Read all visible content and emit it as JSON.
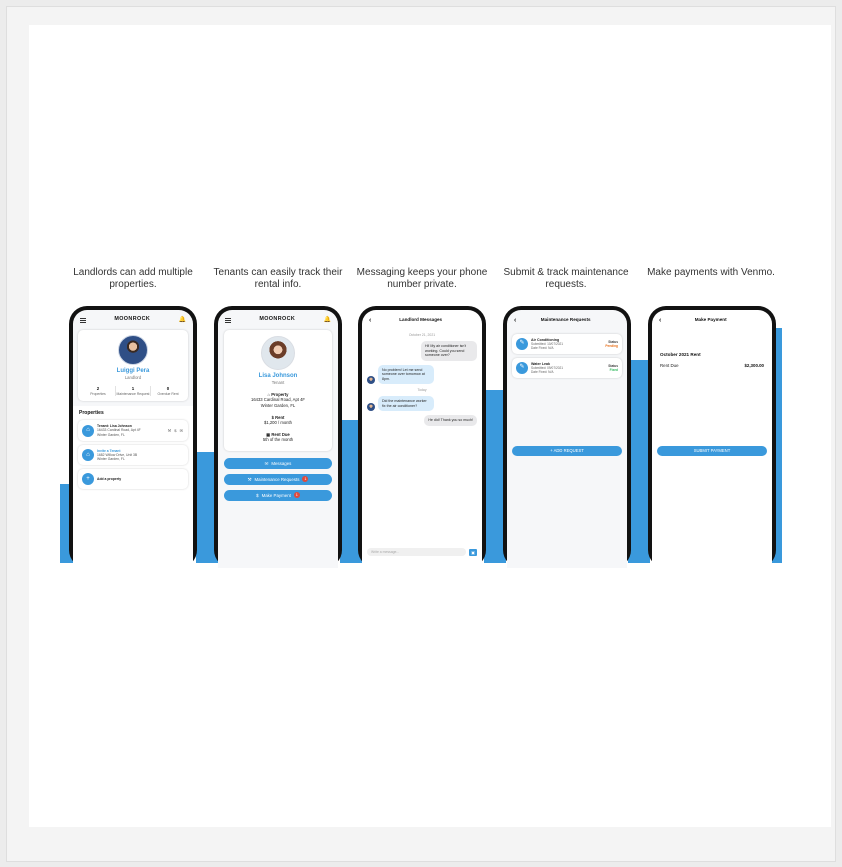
{
  "captions": [
    "Landlords can add multiple properties.",
    "Tenants can easily track their rental info.",
    "Messaging keeps your phone number private.",
    "Submit & track maintenance requests.",
    "Make payments with Venmo."
  ],
  "brand": {
    "logo": "MOONROCK",
    "accent": "#3a99dc"
  },
  "landlord": {
    "name": "Luiggi Pera",
    "role": "Landlord",
    "stats": [
      {
        "value": "2",
        "label": "Properties"
      },
      {
        "value": "1",
        "label": "Maintenance Request"
      },
      {
        "value": "0",
        "label": "Overdue Rent"
      }
    ],
    "properties_heading": "Properties",
    "properties": [
      {
        "title": "Tenant: Lisa Johnson",
        "line1": "16433 Cardinal Road, Apt 4F",
        "line2": "Winter Garden, FL",
        "icons": "⚒ $ ✉"
      },
      {
        "title": "Invite a Tenant",
        "line1": "1682 Willow Drive, Unit 3B",
        "line2": "Winter Garden, FL"
      }
    ],
    "add_label": "Add a property"
  },
  "tenant": {
    "name": "Lisa Johnson",
    "role": "Tenant",
    "property_label": "Property",
    "address1": "16433 Cardinal Road, Apt 4F",
    "address2": "Winter Garden, FL",
    "rent_label": "Rent",
    "rent_value": "$1,200 / month",
    "due_label": "Rent Due",
    "due_value": "5th of the month",
    "buttons": [
      {
        "label": "Messages",
        "icon": "✉",
        "badge": ""
      },
      {
        "label": "Maintenance Requests",
        "icon": "⚒",
        "badge": "1"
      },
      {
        "label": "Make Payment",
        "icon": "$",
        "badge": "1"
      }
    ]
  },
  "messages": {
    "title": "Landlord Messages",
    "date1": "October 21, 2021",
    "date2": "Today",
    "thread": [
      {
        "from": "me",
        "text": "Hi! My air conditioner isn't working. Could you send someone over?"
      },
      {
        "from": "them",
        "text": "No problem! Let me send someone over tomorrow at 8pm."
      },
      {
        "from": "them",
        "text": "Did the maintenance worker fix the air conditioner?"
      },
      {
        "from": "me",
        "text": "He did! Thank you so much!"
      }
    ],
    "placeholder": "Write a message..."
  },
  "maintenance": {
    "title": "Maintenance Requests",
    "items": [
      {
        "title": "Air Conditioning",
        "submitted": "Submitted: 10/07/2021",
        "fixed": "Date Fixed: N/A",
        "status_label": "Status",
        "status": "Pending"
      },
      {
        "title": "Water Leak",
        "submitted": "Submitted: 09/07/2021",
        "fixed": "Date Fixed: N/A",
        "status_label": "Status",
        "status": "Fixed"
      }
    ],
    "add_button": "+ ADD REQUEST"
  },
  "payment": {
    "title": "Make Payment",
    "heading": "October 2021 Rent",
    "due_label": "Rent Due",
    "due_value": "$2,300.00",
    "submit": "SUBMIT PAYMENT"
  }
}
